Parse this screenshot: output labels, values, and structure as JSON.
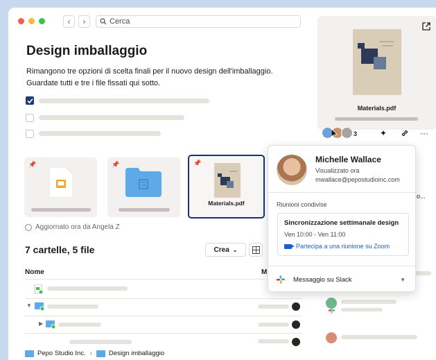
{
  "search": {
    "placeholder": "Cerca"
  },
  "page": {
    "title": "Design imballaggio",
    "description": "Rimangono tre opzioni di scelta finali per il nuovo design dell'imballaggio. Guardate tutti e tre i file fissati qui sotto."
  },
  "tasks": [
    {
      "checked": true
    },
    {
      "checked": false
    },
    {
      "checked": false
    }
  ],
  "pinned": {
    "selected_label": "Materials.pdf"
  },
  "activity": {
    "updated": "Aggiornato ora da Angela Z"
  },
  "listing": {
    "count": "7 cartelle, 5 file",
    "create_label": "Crea",
    "col_name": "Nome",
    "col_member": "M"
  },
  "preview": {
    "file_name": "Materials.pdf"
  },
  "viewers": {
    "extra_count": "3"
  },
  "card": {
    "name": "Michelle Wallace",
    "status": "Visualizzato ora",
    "email": "mwallace@pepostudioinc.com",
    "shared_meetings": "Riunioni condivise",
    "meeting_title": "Sincronizzazione settimanale design",
    "meeting_time": "Ven 10:00 - Ven 11:00",
    "zoom_link": "Partecipa a una riunione su Zoom",
    "slack": "Messaggio su Slack"
  },
  "overflow_text": "o...",
  "breadcrumb": {
    "root": "Pepo Studio Inc.",
    "current": "Design imballaggio"
  },
  "colors": {
    "accent": "#1b2e78",
    "zoom": "#1b5fd6",
    "folder": "#5ea9e8"
  }
}
